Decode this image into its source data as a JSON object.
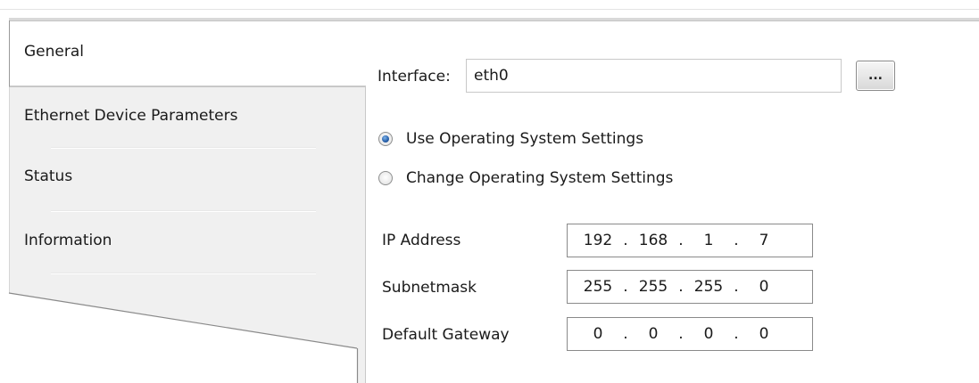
{
  "tabs": [
    {
      "label": "General",
      "selected": true
    },
    {
      "label": "Ethernet Device Parameters",
      "selected": false
    },
    {
      "label": "Status",
      "selected": false
    },
    {
      "label": "Information",
      "selected": false
    }
  ],
  "interface": {
    "label": "Interface:",
    "value": "eth0",
    "browse_label": "..."
  },
  "radios": [
    {
      "label": "Use Operating System Settings",
      "checked": true
    },
    {
      "label": "Change Operating System Settings",
      "checked": false
    }
  ],
  "ip_fields": [
    {
      "label": "IP Address",
      "octets": [
        "192",
        "168",
        "1",
        "7"
      ]
    },
    {
      "label": "Subnetmask",
      "octets": [
        "255",
        "255",
        "255",
        "0"
      ]
    },
    {
      "label": "Default Gateway",
      "octets": [
        "0",
        "0",
        "0",
        "0"
      ]
    }
  ],
  "ip_separator": ".",
  "colors": {
    "selected_tab": "#ffffff",
    "tab_background": "#f0f0f0",
    "radio_selected": "#2a63ad"
  }
}
